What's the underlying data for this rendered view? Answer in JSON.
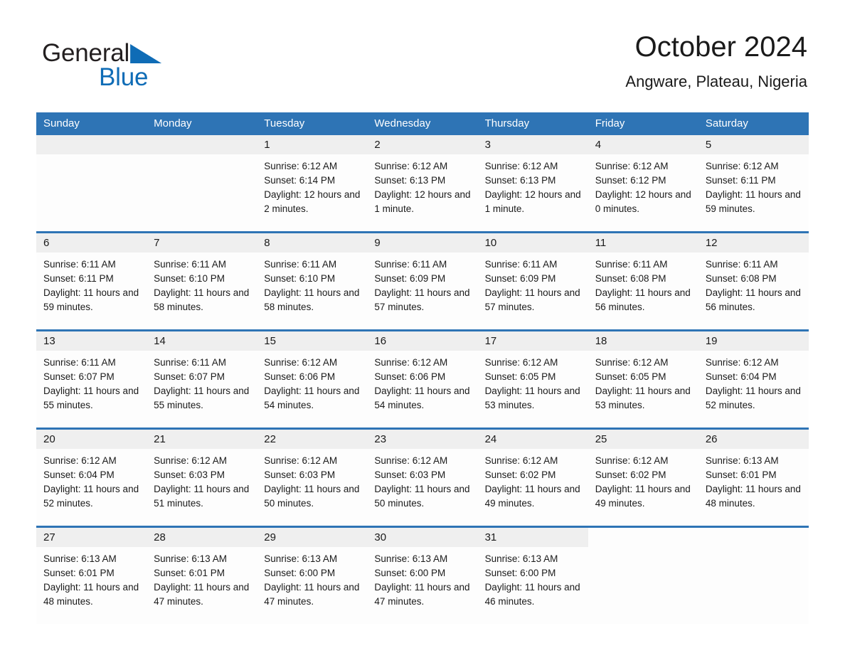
{
  "brand": {
    "word_one": "General",
    "word_two": "Blue",
    "flag_icon": "triangle-flag-icon",
    "accent_color": "#0f6cb6"
  },
  "header": {
    "month_title": "October 2024",
    "location": "Angware, Plateau, Nigeria"
  },
  "theme": {
    "header_blue": "#2e74b5",
    "daynum_band": "#efefef",
    "cell_background": "#fdfdfd",
    "text_color": "#1a1a1a"
  },
  "calendar": {
    "weekday_headers": [
      "Sunday",
      "Monday",
      "Tuesday",
      "Wednesday",
      "Thursday",
      "Friday",
      "Saturday"
    ],
    "labels": {
      "sunrise_prefix": "Sunrise:",
      "sunset_prefix": "Sunset:",
      "daylight_prefix": "Daylight:"
    },
    "weeks": [
      {
        "days": [
          {
            "date": "",
            "empty": true
          },
          {
            "date": "",
            "empty": true
          },
          {
            "date": "1",
            "sunrise": "Sunrise: 6:12 AM",
            "sunset": "Sunset: 6:14 PM",
            "daylight": "Daylight: 12 hours and 2 minutes."
          },
          {
            "date": "2",
            "sunrise": "Sunrise: 6:12 AM",
            "sunset": "Sunset: 6:13 PM",
            "daylight": "Daylight: 12 hours and 1 minute."
          },
          {
            "date": "3",
            "sunrise": "Sunrise: 6:12 AM",
            "sunset": "Sunset: 6:13 PM",
            "daylight": "Daylight: 12 hours and 1 minute."
          },
          {
            "date": "4",
            "sunrise": "Sunrise: 6:12 AM",
            "sunset": "Sunset: 6:12 PM",
            "daylight": "Daylight: 12 hours and 0 minutes."
          },
          {
            "date": "5",
            "sunrise": "Sunrise: 6:12 AM",
            "sunset": "Sunset: 6:11 PM",
            "daylight": "Daylight: 11 hours and 59 minutes."
          }
        ]
      },
      {
        "days": [
          {
            "date": "6",
            "sunrise": "Sunrise: 6:11 AM",
            "sunset": "Sunset: 6:11 PM",
            "daylight": "Daylight: 11 hours and 59 minutes."
          },
          {
            "date": "7",
            "sunrise": "Sunrise: 6:11 AM",
            "sunset": "Sunset: 6:10 PM",
            "daylight": "Daylight: 11 hours and 58 minutes."
          },
          {
            "date": "8",
            "sunrise": "Sunrise: 6:11 AM",
            "sunset": "Sunset: 6:10 PM",
            "daylight": "Daylight: 11 hours and 58 minutes."
          },
          {
            "date": "9",
            "sunrise": "Sunrise: 6:11 AM",
            "sunset": "Sunset: 6:09 PM",
            "daylight": "Daylight: 11 hours and 57 minutes."
          },
          {
            "date": "10",
            "sunrise": "Sunrise: 6:11 AM",
            "sunset": "Sunset: 6:09 PM",
            "daylight": "Daylight: 11 hours and 57 minutes."
          },
          {
            "date": "11",
            "sunrise": "Sunrise: 6:11 AM",
            "sunset": "Sunset: 6:08 PM",
            "daylight": "Daylight: 11 hours and 56 minutes."
          },
          {
            "date": "12",
            "sunrise": "Sunrise: 6:11 AM",
            "sunset": "Sunset: 6:08 PM",
            "daylight": "Daylight: 11 hours and 56 minutes."
          }
        ]
      },
      {
        "days": [
          {
            "date": "13",
            "sunrise": "Sunrise: 6:11 AM",
            "sunset": "Sunset: 6:07 PM",
            "daylight": "Daylight: 11 hours and 55 minutes."
          },
          {
            "date": "14",
            "sunrise": "Sunrise: 6:11 AM",
            "sunset": "Sunset: 6:07 PM",
            "daylight": "Daylight: 11 hours and 55 minutes."
          },
          {
            "date": "15",
            "sunrise": "Sunrise: 6:12 AM",
            "sunset": "Sunset: 6:06 PM",
            "daylight": "Daylight: 11 hours and 54 minutes."
          },
          {
            "date": "16",
            "sunrise": "Sunrise: 6:12 AM",
            "sunset": "Sunset: 6:06 PM",
            "daylight": "Daylight: 11 hours and 54 minutes."
          },
          {
            "date": "17",
            "sunrise": "Sunrise: 6:12 AM",
            "sunset": "Sunset: 6:05 PM",
            "daylight": "Daylight: 11 hours and 53 minutes."
          },
          {
            "date": "18",
            "sunrise": "Sunrise: 6:12 AM",
            "sunset": "Sunset: 6:05 PM",
            "daylight": "Daylight: 11 hours and 53 minutes."
          },
          {
            "date": "19",
            "sunrise": "Sunrise: 6:12 AM",
            "sunset": "Sunset: 6:04 PM",
            "daylight": "Daylight: 11 hours and 52 minutes."
          }
        ]
      },
      {
        "days": [
          {
            "date": "20",
            "sunrise": "Sunrise: 6:12 AM",
            "sunset": "Sunset: 6:04 PM",
            "daylight": "Daylight: 11 hours and 52 minutes."
          },
          {
            "date": "21",
            "sunrise": "Sunrise: 6:12 AM",
            "sunset": "Sunset: 6:03 PM",
            "daylight": "Daylight: 11 hours and 51 minutes."
          },
          {
            "date": "22",
            "sunrise": "Sunrise: 6:12 AM",
            "sunset": "Sunset: 6:03 PM",
            "daylight": "Daylight: 11 hours and 50 minutes."
          },
          {
            "date": "23",
            "sunrise": "Sunrise: 6:12 AM",
            "sunset": "Sunset: 6:03 PM",
            "daylight": "Daylight: 11 hours and 50 minutes."
          },
          {
            "date": "24",
            "sunrise": "Sunrise: 6:12 AM",
            "sunset": "Sunset: 6:02 PM",
            "daylight": "Daylight: 11 hours and 49 minutes."
          },
          {
            "date": "25",
            "sunrise": "Sunrise: 6:12 AM",
            "sunset": "Sunset: 6:02 PM",
            "daylight": "Daylight: 11 hours and 49 minutes."
          },
          {
            "date": "26",
            "sunrise": "Sunrise: 6:13 AM",
            "sunset": "Sunset: 6:01 PM",
            "daylight": "Daylight: 11 hours and 48 minutes."
          }
        ]
      },
      {
        "days": [
          {
            "date": "27",
            "sunrise": "Sunrise: 6:13 AM",
            "sunset": "Sunset: 6:01 PM",
            "daylight": "Daylight: 11 hours and 48 minutes."
          },
          {
            "date": "28",
            "sunrise": "Sunrise: 6:13 AM",
            "sunset": "Sunset: 6:01 PM",
            "daylight": "Daylight: 11 hours and 47 minutes."
          },
          {
            "date": "29",
            "sunrise": "Sunrise: 6:13 AM",
            "sunset": "Sunset: 6:00 PM",
            "daylight": "Daylight: 11 hours and 47 minutes."
          },
          {
            "date": "30",
            "sunrise": "Sunrise: 6:13 AM",
            "sunset": "Sunset: 6:00 PM",
            "daylight": "Daylight: 11 hours and 47 minutes."
          },
          {
            "date": "31",
            "sunrise": "Sunrise: 6:13 AM",
            "sunset": "Sunset: 6:00 PM",
            "daylight": "Daylight: 11 hours and 46 minutes."
          },
          {
            "date": "",
            "blank": true
          },
          {
            "date": "",
            "blank": true
          }
        ]
      }
    ]
  }
}
